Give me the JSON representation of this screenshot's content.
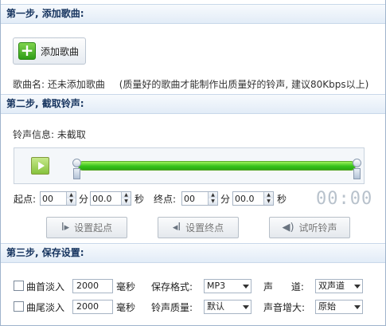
{
  "step1": {
    "title": "第一步, 添加歌曲:",
    "add_button_label": "添加歌曲",
    "song_name_label": "歌曲名: ",
    "song_name_value": "还未添加歌曲",
    "quality_note": "(质量好的歌曲才能制作出质量好的铃声, 建议80Kbps以上)"
  },
  "step2": {
    "title": "第二步, 截取铃声:",
    "ringtone_info_label": "铃声信息: ",
    "ringtone_info_value": "未截取",
    "start_label": "起点:",
    "end_label": "终点:",
    "min_unit": "分",
    "sec_unit": "秒",
    "start_min": "00",
    "start_sec": "00.0",
    "end_min": "00",
    "end_sec": "00.0",
    "timecode": "00:00",
    "set_start_label": "设置起点",
    "set_end_label": "设置终点",
    "preview_label": "试听铃声"
  },
  "step3": {
    "title": "第三步, 保存设置:",
    "fade_in_label": "曲首淡入",
    "fade_in_value": "2000",
    "fade_out_label": "曲尾淡入",
    "fade_out_value": "2000",
    "ms_unit": "毫秒",
    "format_label": "保存格式:",
    "format_value": "MP3",
    "quality_label": "铃声质量:",
    "quality_value": "默认",
    "channel_label": "声      道:",
    "channel_value": "双声道",
    "volume_label": "声音增大:",
    "volume_value": "原始"
  },
  "colors": {
    "header_text": "#15335e",
    "progress_green": "#35c21b",
    "border": "#9fb4cc"
  }
}
